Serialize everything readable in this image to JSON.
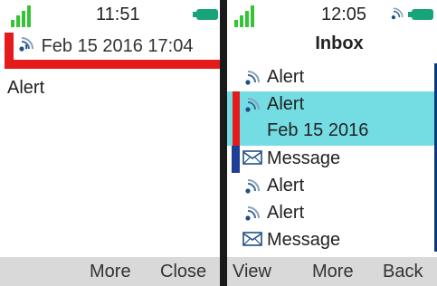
{
  "colors": {
    "signal": "#35c435",
    "battery": "#19a37a",
    "alarm_red": "#e51b1b",
    "selection": "#74dde3",
    "unread_marker": "#1f3f95",
    "softkey_bar": "#d9d9d9"
  },
  "left": {
    "status": {
      "time": "11:51"
    },
    "header": {
      "title": "Feb 15 2016 17:04",
      "icon": "alert-icon"
    },
    "body": "Alert",
    "softkeys": {
      "more": "More",
      "close": "Close"
    }
  },
  "right": {
    "status": {
      "time": "12:05"
    },
    "title": "Inbox",
    "items": [
      {
        "type": "alert-icon",
        "label": "Alert"
      },
      {
        "type": "alert-icon",
        "label": "Alert",
        "sublabel": "Feb 15 2016",
        "selected": true,
        "marker": "red"
      },
      {
        "type": "mail-icon",
        "label": "Message",
        "marker": "blue"
      },
      {
        "type": "alert-icon",
        "label": "Alert"
      },
      {
        "type": "alert-icon",
        "label": "Alert"
      },
      {
        "type": "mail-icon",
        "label": "Message"
      }
    ],
    "softkeys": {
      "view": "View",
      "more": "More",
      "back": "Back"
    }
  }
}
